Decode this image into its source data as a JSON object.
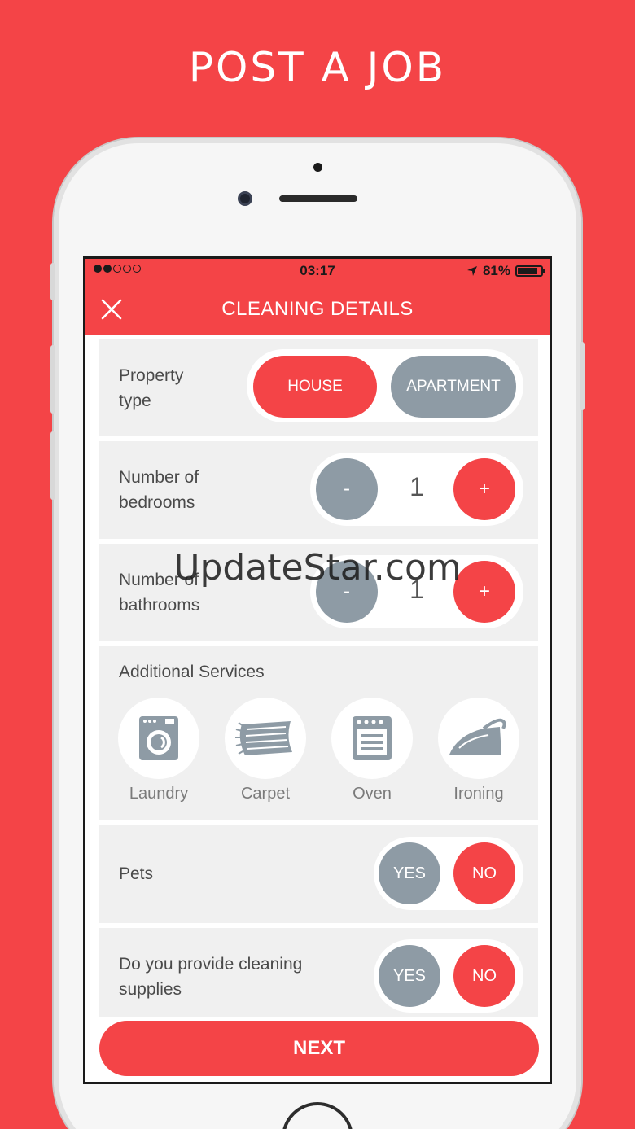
{
  "headline": "POST A JOB",
  "status": {
    "time": "03:17",
    "battery": "81%",
    "signal_bars_filled": 2,
    "signal_bars_total": 5
  },
  "nav": {
    "title": "CLEANING DETAILS",
    "close_icon": "close-icon"
  },
  "property_type": {
    "label": "Property type",
    "options": [
      "HOUSE",
      "APARTMENT"
    ],
    "selected": "HOUSE"
  },
  "bedrooms": {
    "label": "Number of bedrooms",
    "minus": "-",
    "value": "1",
    "plus": "+"
  },
  "bathrooms": {
    "label": "Number of bathrooms",
    "minus": "-",
    "value": "1",
    "plus": "+"
  },
  "services": {
    "label": "Additional Services",
    "items": [
      {
        "label": "Laundry",
        "icon": "washing-machine-icon"
      },
      {
        "label": "Carpet",
        "icon": "carpet-icon"
      },
      {
        "label": "Oven",
        "icon": "oven-icon"
      },
      {
        "label": "Ironing",
        "icon": "iron-icon"
      }
    ]
  },
  "pets": {
    "label": "Pets",
    "yes": "YES",
    "no": "NO",
    "selected": "NO"
  },
  "supplies": {
    "label": "Do you provide cleaning supplies",
    "yes": "YES",
    "no": "NO",
    "selected": "NO"
  },
  "next_label": "NEXT",
  "watermark": "UpdateStar.com",
  "colors": {
    "accent": "#f44447",
    "grey": "#8e9ba5",
    "card": "#f0f0f0"
  }
}
